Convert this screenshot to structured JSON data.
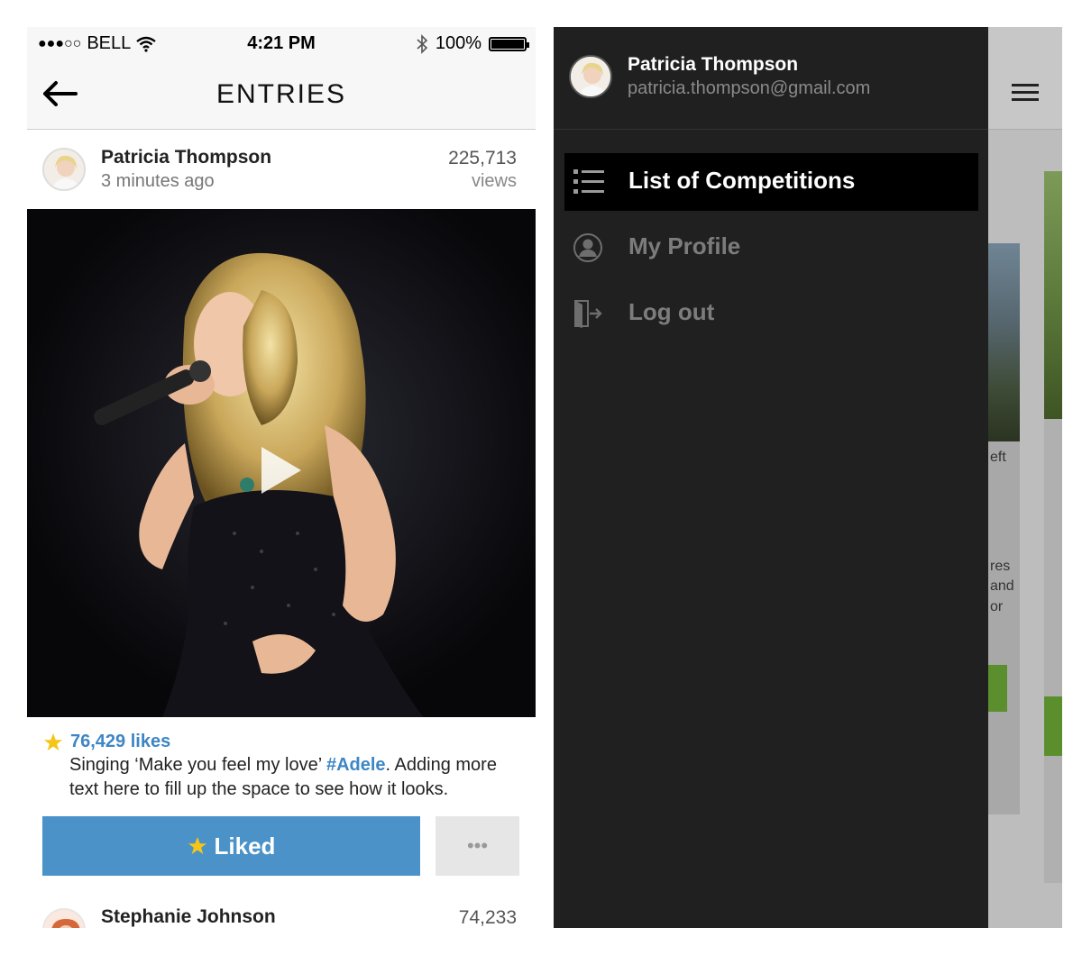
{
  "status_bar": {
    "signal": "●●●○○",
    "carrier": "BELL",
    "time": "4:21 PM",
    "battery": "100%"
  },
  "nav": {
    "title": "ENTRIES"
  },
  "entry": {
    "user_name": "Patricia Thompson",
    "posted": "3 minutes ago",
    "views_count": "225,713",
    "views_label": "views",
    "likes": "76,429 likes",
    "caption_before": "Singing ‘Make you feel my love’ ",
    "caption_tag": "#Adele",
    "caption_after": ". Adding more text here to fill up the space to see how it looks.",
    "liked_label": "Liked",
    "more_label": "•••"
  },
  "next_entry": {
    "user_name": "Stephanie Johnson",
    "views_count": "74,233"
  },
  "drawer": {
    "user_name": "Patricia Thompson",
    "email": "patricia.thompson@gmail.com",
    "items": [
      {
        "label": "List of Competitions",
        "icon": "list-icon",
        "active": true
      },
      {
        "label": "My Profile",
        "icon": "profile-icon",
        "active": false
      },
      {
        "label": "Log out",
        "icon": "logout-icon",
        "active": false
      }
    ]
  },
  "background_fragments": {
    "t1": "eft",
    "t2": "res",
    "t3": "and",
    "t4": "or"
  },
  "colors": {
    "accent_blue": "#4a92c8",
    "link_blue": "#3d86c6",
    "star_yellow": "#f5c518",
    "drawer_bg": "#202020"
  }
}
